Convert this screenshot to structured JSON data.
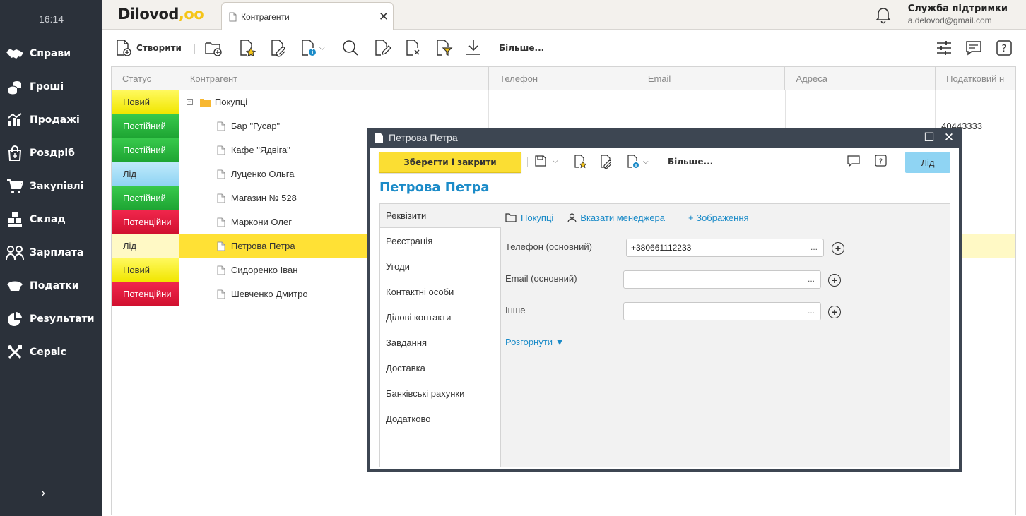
{
  "sidebar": {
    "time": "16:14",
    "items": [
      {
        "label": "Справи",
        "icon": "handshake-icon"
      },
      {
        "label": "Гроші",
        "icon": "coins-icon"
      },
      {
        "label": "Продажі",
        "icon": "sales-chart-icon"
      },
      {
        "label": "Роздріб",
        "icon": "shopping-bag-icon"
      },
      {
        "label": "Закупівлі",
        "icon": "cart-icon"
      },
      {
        "label": "Склад",
        "icon": "boxes-icon"
      },
      {
        "label": "Зарплата",
        "icon": "people-icon"
      },
      {
        "label": "Податки",
        "icon": "officer-cap-icon"
      },
      {
        "label": "Результати",
        "icon": "pie-chart-icon"
      },
      {
        "label": "Сервіс",
        "icon": "tools-icon"
      }
    ],
    "expand": "›"
  },
  "header": {
    "logo": "Dilovod",
    "logo_dots": ",oo",
    "tab_label": "Контрагенти",
    "support_title": "Служба підтримки",
    "support_email": "a.delovod@gmail.com"
  },
  "toolbar": {
    "create_label": "Створити",
    "more_label": "Більше..."
  },
  "grid": {
    "columns": [
      "Статус",
      "Контрагент",
      "Телефон",
      "Email",
      "Адреса",
      "Податковий н"
    ],
    "group_label": "Покупці",
    "rows": [
      {
        "status": "Постійний",
        "name": "Бар \"Гусар\"",
        "tax": "40443333"
      },
      {
        "status": "Постійний",
        "name": "Кафе \"Ядвіга\"",
        "tax": ""
      },
      {
        "status": "Лід",
        "name": "Луценко Ольга",
        "tax": ""
      },
      {
        "status": "Постійний",
        "name": "Магазин № 528",
        "tax": ""
      },
      {
        "status": "Потенційни",
        "name": "Маркони Олег",
        "tax": ""
      },
      {
        "status": "Лід",
        "name": "Петрова Петра",
        "tax": ""
      },
      {
        "status": "Новий",
        "name": "Сидоренко Іван",
        "tax": ""
      },
      {
        "status": "Потенційни",
        "name": "Шевченко Дмитро",
        "tax": ""
      }
    ],
    "group_status": "Новий"
  },
  "modal": {
    "title": "Петрова Петра",
    "save_label": "Зберегти і закрити",
    "more_label": "Більше...",
    "status_label": "Лід",
    "name": "Петрова Петра",
    "sections": [
      "Реквізити",
      "Реєстрація",
      "Угоди",
      "Контактні особи",
      "Ділові контакти",
      "Завдання",
      "Доставка",
      "Банківські рахунки",
      "Додатково"
    ],
    "folder_link": "Покупці",
    "manager_link": "Вказати менеджера",
    "image_link": "+ Зображення",
    "phone_label": "Телефон (основний)",
    "phone_value": "+380661112233",
    "email_label": "Email (основний)",
    "other_label": "Інше",
    "expand_link": "Розгорнути ▼",
    "dots": "..."
  }
}
